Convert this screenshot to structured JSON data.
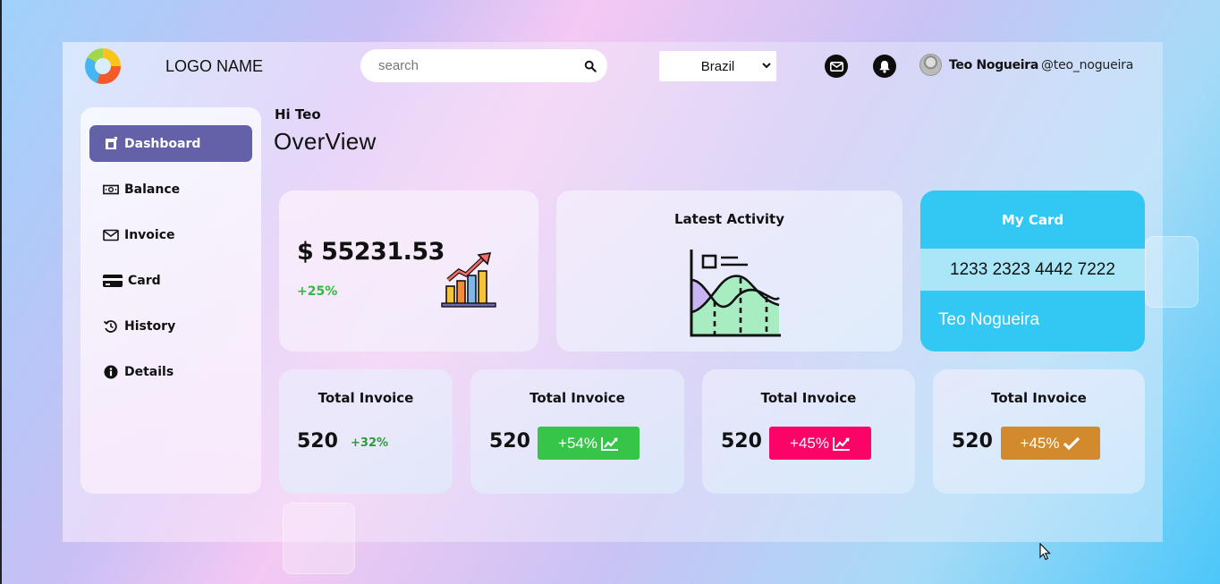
{
  "header": {
    "logo_name": "LOGO NAME",
    "search_placeholder": "search",
    "country_selected": "Brazil",
    "user_name": "Teo Nogueira",
    "user_handle": "@teo_nogueira"
  },
  "sidebar": {
    "items": [
      {
        "label": "Dashboard",
        "icon": "dashboard-icon",
        "active": true
      },
      {
        "label": "Balance",
        "icon": "money-bill-icon"
      },
      {
        "label": "Invoice",
        "icon": "envelope-icon"
      },
      {
        "label": "Card",
        "icon": "credit-card-icon"
      },
      {
        "label": "History",
        "icon": "history-icon"
      },
      {
        "label": "Details",
        "icon": "info-icon"
      }
    ]
  },
  "main": {
    "greeting": "Hi Teo",
    "title": "OverView",
    "balance": {
      "amount": "$ 55231.53",
      "change": "+25%"
    },
    "activity": {
      "title": "Latest Activity"
    },
    "my_card": {
      "title": "My Card",
      "number": "1233 2323 4442 7222",
      "holder": "Teo Nogueira"
    },
    "stats": [
      {
        "title": "Total Invoice",
        "value": "520",
        "change": "+32%"
      },
      {
        "title": "Total Invoice",
        "value": "520",
        "change": "+54%",
        "color": "#36c548"
      },
      {
        "title": "Total Invoice",
        "value": "520",
        "change": "+45%",
        "color": "#fc0367"
      },
      {
        "title": "Total Invoice",
        "value": "520",
        "change": "+45%",
        "color": "#d38a2c"
      }
    ]
  },
  "colors": {
    "accent": "#6362a8",
    "card_blue": "#33c7f4",
    "positive": "#2ebd3c"
  }
}
